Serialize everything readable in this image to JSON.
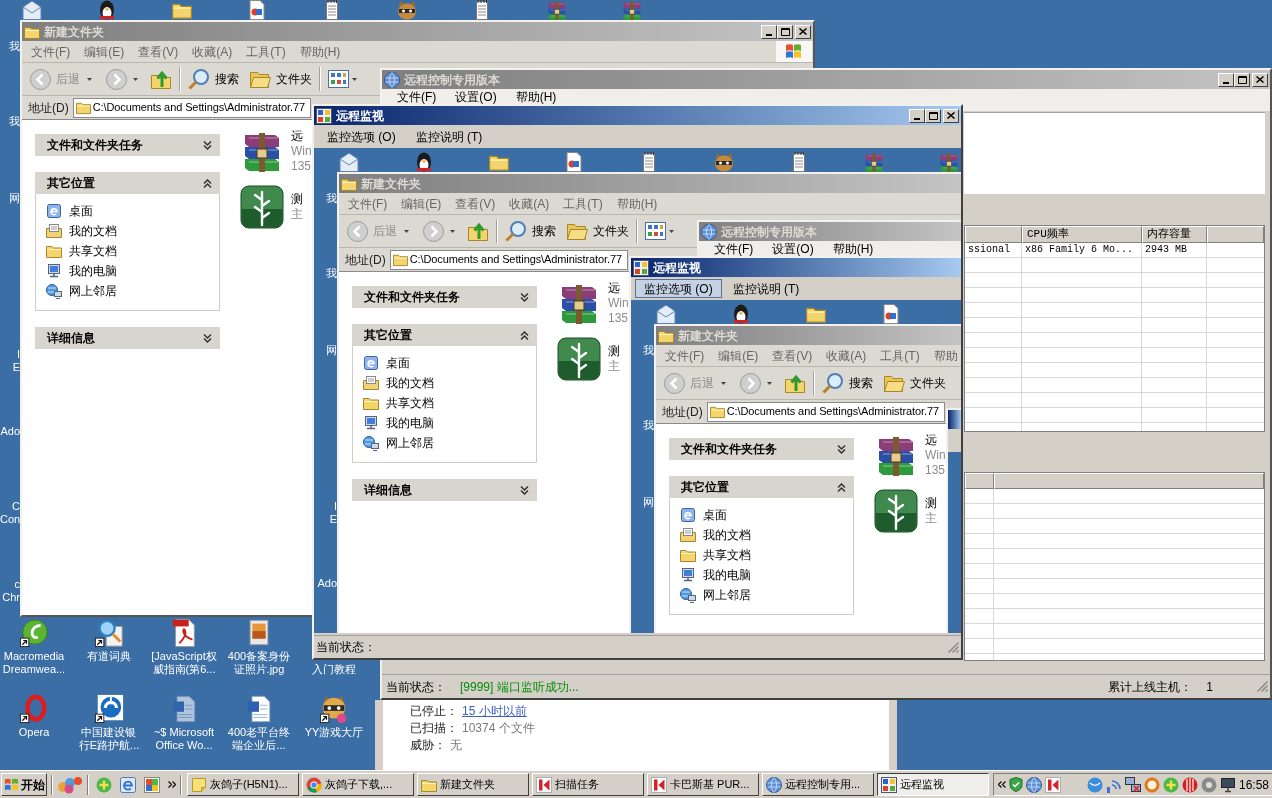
{
  "edge_labels": [
    {
      "lines": [
        "我"
      ]
    },
    {
      "lines": [
        "我"
      ]
    },
    {
      "lines": [
        "网"
      ]
    },
    {
      "lines": [
        "I",
        "E"
      ]
    },
    {
      "lines": [
        "Ado"
      ]
    },
    {
      "lines": [
        "C",
        "Con"
      ]
    },
    {
      "lines": [
        "c",
        "Chr"
      ]
    }
  ],
  "explorer": {
    "title": "新建文件夹",
    "active": false,
    "menu": [
      "文件(F)",
      "编辑(E)",
      "查看(V)",
      "收藏(A)",
      "工具(T)",
      "帮助(H)"
    ],
    "back": "后退",
    "search": "搜索",
    "folders": "文件夹",
    "address_label": "地址(D)",
    "address": "C:\\Documents and Settings\\Administrator.77",
    "task_pane": [
      {
        "title": "文件和文件夹任务",
        "expanded": false
      },
      {
        "title": "其它位置",
        "expanded": true,
        "items": [
          "桌面",
          "我的文档",
          "共享文档",
          "我的电脑",
          "网上邻居"
        ]
      },
      {
        "title": "详细信息",
        "expanded": false
      }
    ],
    "files": [
      {
        "name": "远",
        "details": [
          "Win",
          "135"
        ]
      },
      {
        "name": "测",
        "details": [
          "主"
        ]
      }
    ]
  },
  "remote_control": {
    "title": "远程控制专用版本",
    "active": false,
    "menu": [
      "文件(F)",
      "设置(O)",
      "帮助(H)"
    ],
    "hosts_table": {
      "columns": [
        "",
        "CPU频率",
        "内存容量"
      ],
      "rows": [
        [
          "ssional",
          "x86 Family 6 Mo...",
          "2943 MB"
        ]
      ]
    },
    "status": {
      "label": "当前状态：",
      "message": "[9999] 端口监听成功...",
      "hosts_label": "累计上线主机：",
      "hosts_count": "1"
    }
  },
  "scan_window": {
    "rows": [
      {
        "label": "已停止：",
        "value": "15 小时以前",
        "kind": "link"
      },
      {
        "label": "已扫描：",
        "value": "10374 个文件",
        "kind": "text"
      },
      {
        "label": "威胁：",
        "value": "无",
        "kind": "text"
      }
    ]
  },
  "remote_monitor": {
    "title": "远程监视",
    "active": true,
    "menu": [
      {
        "label": "监控选项 (O)",
        "selected": false
      },
      {
        "label": "监控说明 (T)",
        "selected": false
      }
    ],
    "screen": {
      "edge_labels": [
        {
          "lines": [
            "我"
          ]
        },
        {
          "lines": [
            "我"
          ]
        },
        {
          "lines": [
            "网"
          ]
        },
        {
          "lines": [
            "I",
            "E"
          ]
        },
        {
          "lines": [
            "Ado"
          ]
        }
      ],
      "explorer": {
        "title": "新建文件夹",
        "active": false,
        "menu": [
          "文件(F)",
          "编辑(E)",
          "查看(V)",
          "收藏(A)",
          "工具(T)",
          "帮助(H)"
        ],
        "back": "后退",
        "search": "搜索",
        "folders": "文件夹",
        "address_label": "地址(D)",
        "address": "C:\\Documents and Settings\\Administrator.77",
        "task_pane": [
          {
            "title": "文件和文件夹任务",
            "expanded": false
          },
          {
            "title": "其它位置",
            "expanded": true,
            "items": [
              "桌面",
              "我的文档",
              "共享文档",
              "我的电脑",
              "网上邻居"
            ]
          },
          {
            "title": "详细信息",
            "expanded": false
          }
        ],
        "files": [
          {
            "name": "远",
            "details": [
              "Win",
              "135"
            ]
          },
          {
            "name": "测",
            "details": [
              "主"
            ]
          }
        ]
      },
      "remote_control": {
        "title": "远程控制专用版本",
        "active": false,
        "menu": [
          "文件(F)",
          "设置(O)",
          "帮助(H)"
        ]
      },
      "remote_monitor": {
        "title": "远程监视",
        "active": true,
        "menu": [
          {
            "label": "监控选项 (O)",
            "selected": true
          },
          {
            "label": "监控说明 (T)",
            "selected": false
          }
        ],
        "screen": {
          "edge_labels": [
            {
              "lines": [
                "我"
              ]
            },
            {
              "lines": [
                "我"
              ]
            },
            {
              "lines": [
                "网"
              ]
            }
          ],
          "explorer": {
            "title": "新建文件夹",
            "active": false,
            "menu": [
              "文件(F)",
              "编辑(E)",
              "查看(V)",
              "收藏(A)",
              "工具(T)",
              "帮助"
            ],
            "back": "后退",
            "search": "搜索",
            "folders": "文件夹",
            "address_label": "地址(D)",
            "address": "C:\\Documents and Settings\\Administrator.77",
            "task_pane": [
              {
                "title": "文件和文件夹任务",
                "expanded": false
              },
              {
                "title": "其它位置",
                "expanded": true,
                "items": [
                  "桌面",
                  "我的文档",
                  "共享文档",
                  "我的电脑",
                  "网上邻居"
                ]
              }
            ],
            "files": [
              {
                "name": "远",
                "details": [
                  "Win",
                  "135"
                ]
              },
              {
                "name": "测",
                "details": [
                  "主"
                ]
              }
            ]
          },
          "remote_monitor": {
            "active": true
          }
        }
      }
    },
    "status": "当前状态："
  },
  "desktop_icons": [
    {
      "lines": [
        "Macromedia",
        "Dreamwea..."
      ]
    },
    {
      "lines": [
        "有道词典"
      ]
    },
    {
      "lines": [
        "[JavaScript权",
        "威指南(第6..."
      ]
    },
    {
      "lines": [
        "400备案身份",
        "证照片.jpg"
      ]
    },
    {
      "lines": [
        "入门教程"
      ]
    },
    {
      "lines": [
        "Opera"
      ]
    },
    {
      "lines": [
        "中国建设银",
        "行E路护航..."
      ]
    },
    {
      "lines": [
        "~$ Microsoft",
        "Office Wo..."
      ]
    },
    {
      "lines": [
        "400老平台终",
        "端企业后..."
      ]
    },
    {
      "lines": [
        "YY游戏大厅"
      ]
    }
  ],
  "taskbar": {
    "start": "开始",
    "tasks": [
      {
        "label": "灰鸽子(H5N1)...",
        "selected": false
      },
      {
        "label": "灰鸽子下载,...",
        "selected": false
      },
      {
        "label": "新建文件夹",
        "selected": false
      },
      {
        "label": "扫描任务",
        "selected": false
      },
      {
        "label": "卡巴斯基 PUR...",
        "selected": false
      },
      {
        "label": "远程控制专用...",
        "selected": false
      },
      {
        "label": "远程监视",
        "selected": true
      }
    ],
    "clock": "16:58"
  }
}
